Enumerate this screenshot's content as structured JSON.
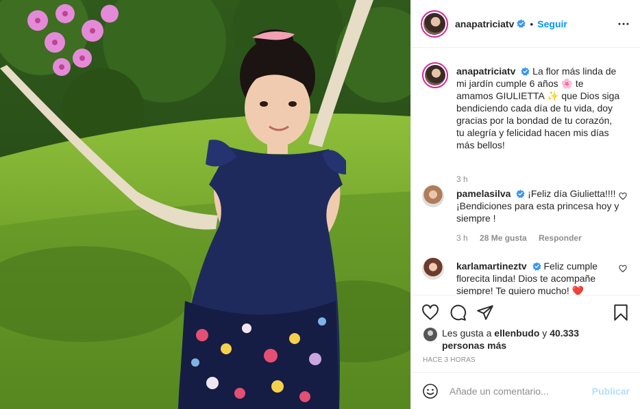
{
  "header": {
    "username": "anapatriciatv",
    "separator": "•",
    "follow_label": "Seguir"
  },
  "caption": {
    "username": "anapatriciatv",
    "text_1": "La flor más linda de mi jardín cumple 6 años",
    "emoji_1": "🌸",
    "text_2": "te amamos GIULIETTA",
    "emoji_2": "✨",
    "text_3": "que Dios siga bendiciendo cada día de tu vida, doy gracias por la bondad de tu corazón, tu alegría y felicidad hacen mis días más bellos!",
    "time": "3 h"
  },
  "comments": [
    {
      "username": "pamelasilva",
      "text": "¡Feliz día Giulietta!!!! ¡Bendiciones para esta princesa hoy y siempre !",
      "time": "3 h",
      "likes": "28 Me gusta",
      "reply_label": "Responder"
    },
    {
      "username": "karlamartineztv",
      "text": "Feliz cumple florecita linda! Dios te acompañe siempre! Te quiero mucho!",
      "emoji": "❤️"
    }
  ],
  "likes": {
    "prefix": "Les gusta a",
    "user": "ellenbudo",
    "joiner": "y",
    "count": "40.333 personas más"
  },
  "time_ago": "Hace 3 horas",
  "add_comment": {
    "placeholder": "Añade un comentario...",
    "publish_label": "Publicar"
  },
  "colors": {
    "link_blue": "#0095f6",
    "publish_disabled": "#b2dffc",
    "verified_blue": "#3897f0",
    "muted": "#8e8e8e"
  },
  "icons": [
    "verified-icon",
    "more-options-icon",
    "heart-icon",
    "comment-icon",
    "share-icon",
    "save-icon",
    "emoji-icon"
  ]
}
